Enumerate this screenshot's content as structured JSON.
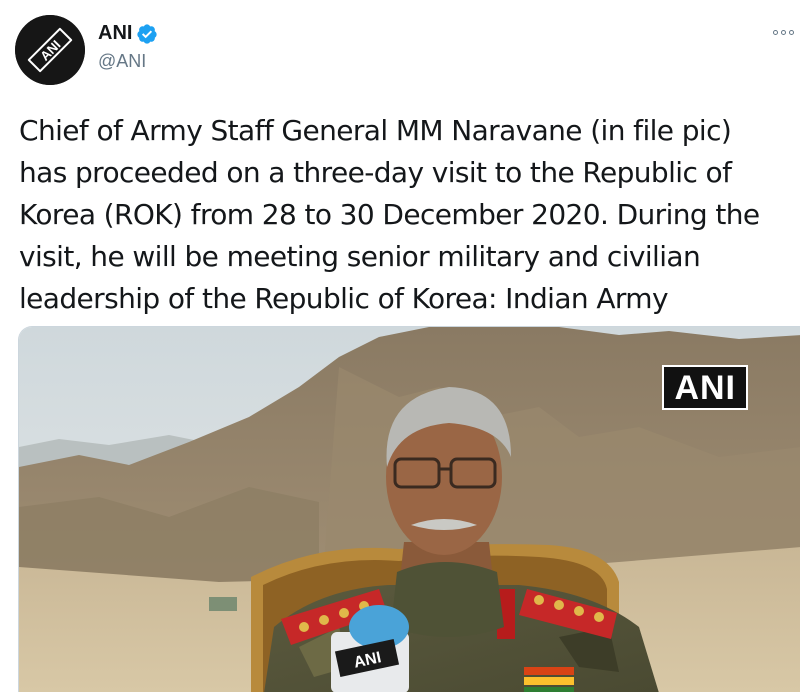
{
  "author": {
    "name": "ANI",
    "handle": "@ANI",
    "verified": true,
    "avatar_logo_text": "ANI"
  },
  "tweet": {
    "lines": [
      "Chief of Army Staff General MM Naravane (in file pic)",
      "has proceeded on a three-day visit to the Republic of",
      "Korea (ROK) from 28 to 30 December 2020. During the",
      "visit, he will be meeting senior military and civilian",
      "leadership of the Republic of Korea: Indian Army"
    ]
  },
  "media": {
    "watermark": "ANI",
    "mic_logo_text": "ANI"
  },
  "icons": {
    "more": "more-options-icon",
    "verified": "verified-badge-icon"
  },
  "colors": {
    "text": "#14171a",
    "secondary": "#657786",
    "verified": "#1da1f2"
  }
}
